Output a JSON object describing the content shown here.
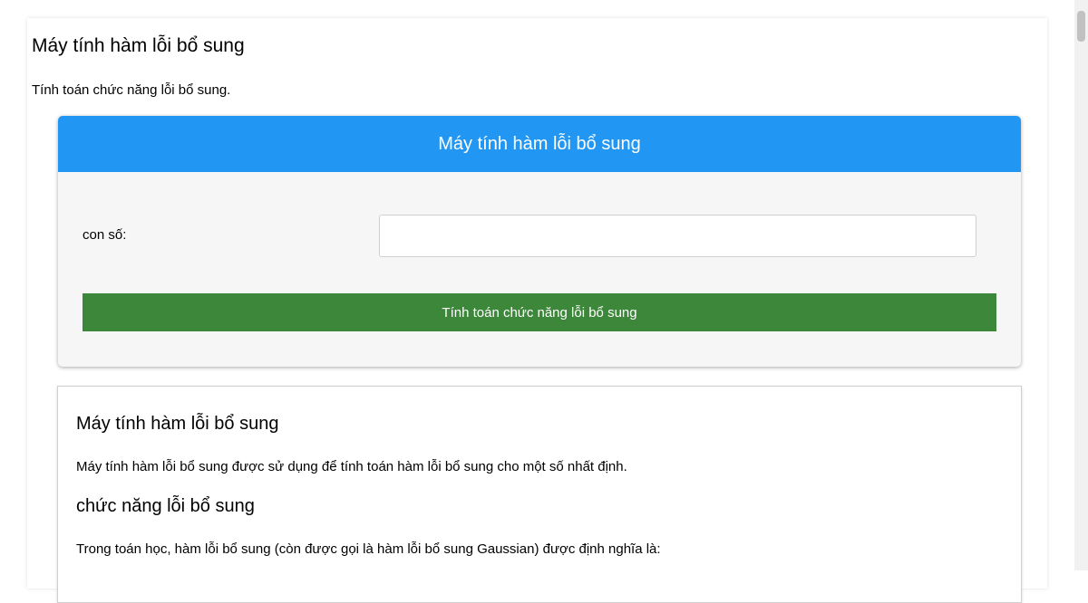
{
  "page": {
    "title": "Máy tính hàm lỗi bổ sung",
    "subtitle": "Tính toán chức năng lỗi bổ sung."
  },
  "calculator": {
    "header": "Máy tính hàm lỗi bổ sung",
    "number_label": "con số:",
    "number_value": "",
    "calculate_button": "Tính toán chức năng lỗi bổ sung"
  },
  "info": {
    "title": "Máy tính hàm lỗi bổ sung",
    "description": "Máy tính hàm lỗi bổ sung được sử dụng để tính toán hàm lỗi bổ sung cho một số nhất định.",
    "subheading": "chức năng lỗi bổ sung",
    "definition": "Trong toán học, hàm lỗi bổ sung (còn được gọi là hàm lỗi bổ sung Gaussian) được định nghĩa là:"
  },
  "colors": {
    "header_blue": "#2196f3",
    "button_green": "#3c873a"
  }
}
